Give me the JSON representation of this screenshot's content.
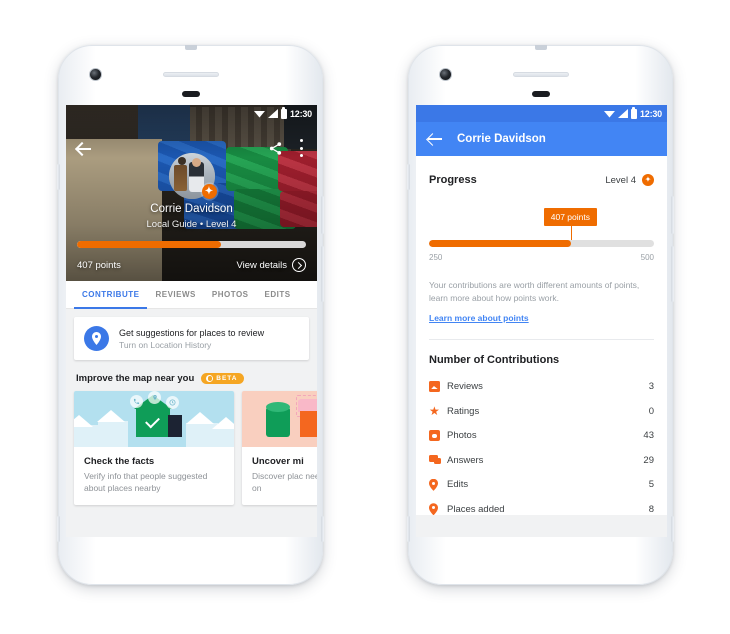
{
  "phone1": {
    "statusbar": {
      "time": "12:30",
      "icons": [
        "wifi-icon",
        "signal-icon",
        "battery-icon"
      ]
    },
    "hero": {
      "back_icon": "back-arrow-icon",
      "share_icon": "share-icon",
      "more_icon": "more-vertical-icon",
      "avatar": "user-avatar",
      "level_badge_glyph": "✦",
      "name": "Corrie Davidson",
      "subtitle": "Local Guide • Level 4",
      "points_label": "407 points",
      "view_details_label": "View details",
      "progress_percent": 63
    },
    "tabs": [
      {
        "label": "CONTRIBUTE",
        "active": true
      },
      {
        "label": "REVIEWS",
        "active": false
      },
      {
        "label": "PHOTOS",
        "active": false
      },
      {
        "label": "EDITS",
        "active": false
      }
    ],
    "suggestion_card": {
      "icon": "location-pin-icon",
      "title": "Get suggestions for places to review",
      "subtitle": "Turn on Location History"
    },
    "improve": {
      "heading": "Improve the map near you",
      "badge": "BETA"
    },
    "cards": [
      {
        "illustration": "neighborhood-houses-illustration",
        "title": "Check the facts",
        "desc": "Verify info that people suggested about places nearby"
      },
      {
        "illustration": "shapes-illustration",
        "title": "Uncover mi",
        "desc": "Discover plac need info on"
      }
    ]
  },
  "phone2": {
    "statusbar": {
      "time": "12:30",
      "icons": [
        "wifi-icon",
        "signal-icon",
        "battery-icon"
      ]
    },
    "appbar": {
      "back_icon": "back-arrow-icon",
      "title": "Corrie Davidson"
    },
    "progress": {
      "heading": "Progress",
      "level_label": "Level 4",
      "level_badge_glyph": "✦",
      "tooltip": "407 points",
      "percent": 63,
      "scale_min": "250",
      "scale_max": "500"
    },
    "note": "Your contributions are worth different amounts of points, learn more about how points work.",
    "link": "Learn more about points",
    "contributions_heading": "Number of Contributions",
    "contributions": [
      {
        "icon": "review-icon",
        "label": "Reviews",
        "value": "3"
      },
      {
        "icon": "star-icon",
        "label": "Ratings",
        "value": "0"
      },
      {
        "icon": "photo-icon",
        "label": "Photos",
        "value": "43"
      },
      {
        "icon": "answers-icon",
        "label": "Answers",
        "value": "29"
      },
      {
        "icon": "map-pin-icon",
        "label": "Edits",
        "value": "5"
      },
      {
        "icon": "map-pin-add-icon",
        "label": "Places added",
        "value": "8"
      }
    ]
  },
  "colors": {
    "orange": "#ef6c00",
    "orange_icon": "#f4671f",
    "blue": "#4285f4",
    "blue_dark": "#3b78e7",
    "green": "#0f9d58",
    "amber": "#f5a623",
    "grey_text": "#9aa0a6",
    "dark_text": "#202124"
  }
}
